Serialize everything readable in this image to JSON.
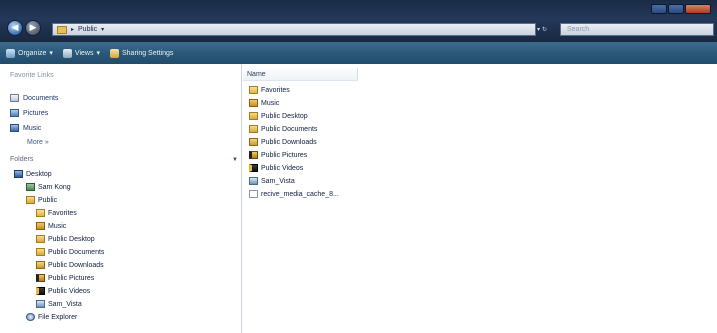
{
  "address": {
    "crumbs": [
      "Public"
    ],
    "search_placeholder": "Search"
  },
  "toolbar": {
    "organize": "Organize",
    "views": "Views",
    "sharing": "Sharing Settings"
  },
  "favorites": {
    "heading": "Favorite Links",
    "items": [
      {
        "label": "Documents",
        "icon": "documents-icon"
      },
      {
        "label": "Pictures",
        "icon": "pictures-icon"
      },
      {
        "label": "Music",
        "icon": "music-icon"
      }
    ],
    "more": "More »"
  },
  "folders": {
    "heading": "Folders",
    "tree": [
      {
        "label": "Desktop",
        "icon": "desktop-icon"
      },
      {
        "label": "Sam Kong",
        "icon": "user-folder-icon"
      },
      {
        "label": "Public",
        "icon": "folder-icon"
      },
      {
        "label": "Favorites",
        "icon": "favorites-folder-icon"
      },
      {
        "label": "Music",
        "icon": "music-folder-icon"
      },
      {
        "label": "Public Desktop",
        "icon": "folder-icon"
      },
      {
        "label": "Public Documents",
        "icon": "folder-icon"
      },
      {
        "label": "Public Downloads",
        "icon": "folder-icon"
      },
      {
        "label": "Public Pictures",
        "icon": "pictures-folder-icon"
      },
      {
        "label": "Public Videos",
        "icon": "videos-folder-icon"
      },
      {
        "label": "Sam_Vista",
        "icon": "folder-icon"
      },
      {
        "label": "File Explorer",
        "icon": "explorer-icon"
      }
    ]
  },
  "content": {
    "column_name": "Name",
    "files": [
      {
        "label": "Favorites",
        "icon": "favorites-folder-icon"
      },
      {
        "label": "Music",
        "icon": "music-folder-icon"
      },
      {
        "label": "Public Desktop",
        "icon": "folder-icon"
      },
      {
        "label": "Public Documents",
        "icon": "folder-icon"
      },
      {
        "label": "Public Downloads",
        "icon": "folder-icon"
      },
      {
        "label": "Public Pictures",
        "icon": "pictures-folder-icon"
      },
      {
        "label": "Public Videos",
        "icon": "videos-folder-icon"
      },
      {
        "label": "Sam_Vista",
        "icon": "folder-icon"
      },
      {
        "label": "recive_media_cache_8...",
        "icon": "file-icon"
      }
    ]
  }
}
